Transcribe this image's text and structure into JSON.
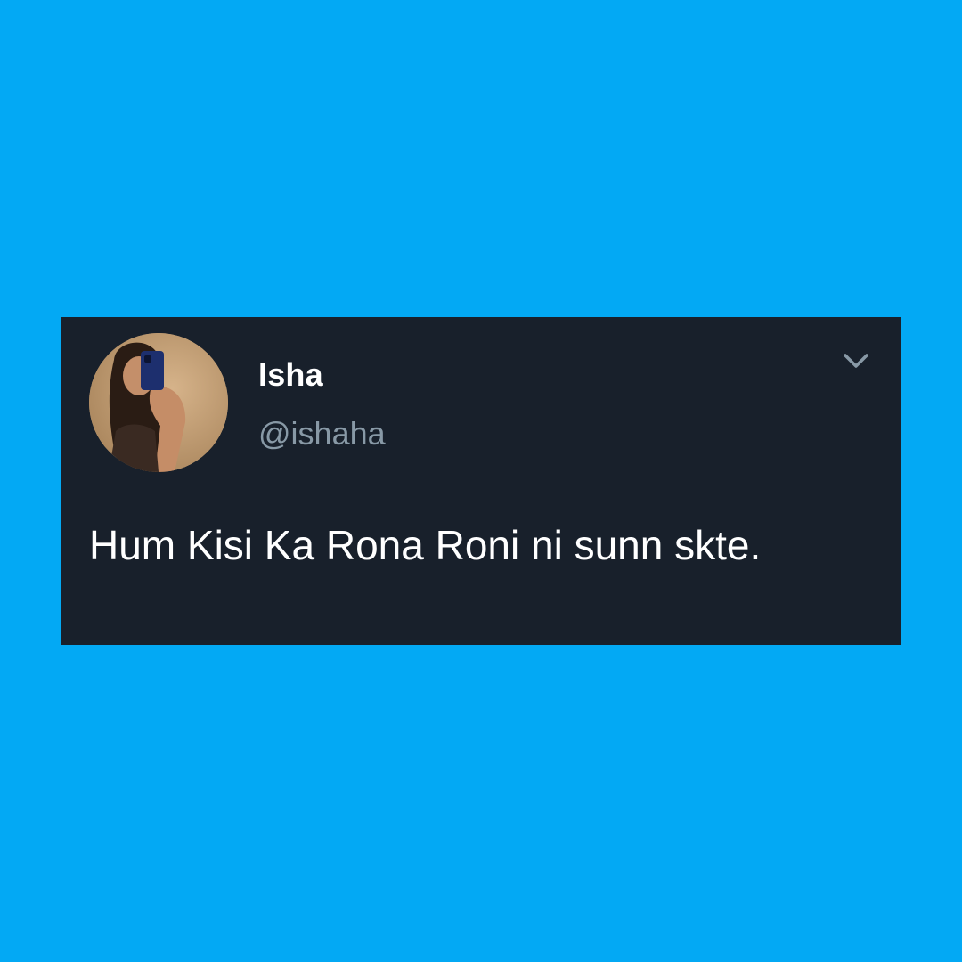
{
  "colors": {
    "background": "#03a9f4",
    "card": "#18202b",
    "name": "#ffffff",
    "handle": "#8899a6",
    "text": "#ffffff"
  },
  "tweet": {
    "display_name": "Isha",
    "handle": "@ishaha",
    "text": "Hum Kisi Ka Rona Roni ni sunn skte.",
    "menu_icon": "chevron-down-icon",
    "avatar": "profile-photo"
  }
}
